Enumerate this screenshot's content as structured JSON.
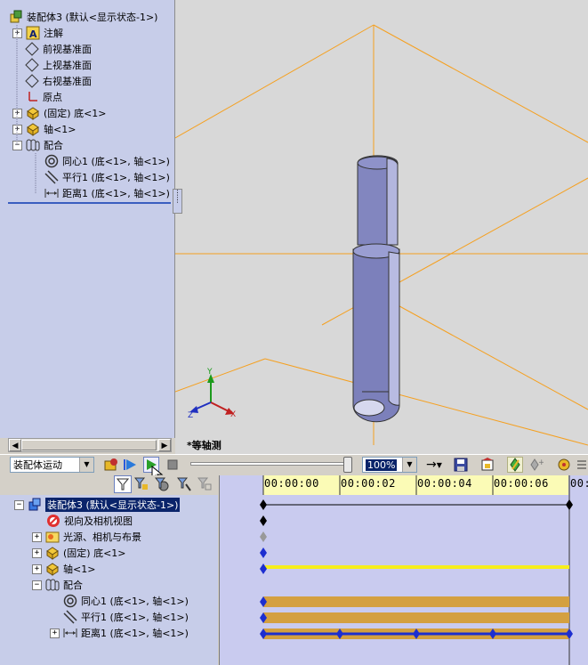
{
  "feature_tree": {
    "root": "装配体3  (默认<显示状态-1>)",
    "items": [
      {
        "label": "注解",
        "icon": "annotation-icon",
        "expandable": true
      },
      {
        "label": "前视基准面",
        "icon": "plane-icon",
        "expandable": false
      },
      {
        "label": "上视基准面",
        "icon": "plane-icon",
        "expandable": false
      },
      {
        "label": "右视基准面",
        "icon": "plane-icon",
        "expandable": false
      },
      {
        "label": "原点",
        "icon": "origin-icon",
        "expandable": false
      },
      {
        "label": "(固定) 底<1>",
        "icon": "part-icon",
        "expandable": true
      },
      {
        "label": "轴<1>",
        "icon": "part-icon",
        "expandable": true
      },
      {
        "label": "配合",
        "icon": "mates-icon",
        "expandable": true,
        "expanded": true
      },
      {
        "label": "同心1  (底<1>, 轴<1>)",
        "icon": "concentric-icon",
        "child": true
      },
      {
        "label": "平行1  (底<1>, 轴<1>)",
        "icon": "parallel-icon",
        "child": true
      },
      {
        "label": "距离1  (底<1>, 轴<1>)",
        "icon": "distance-icon",
        "child": true
      }
    ]
  },
  "viewport": {
    "view_label": "*等轴测"
  },
  "motion_toolbar": {
    "study_type": "装配体运动",
    "zoom": "100%"
  },
  "motion_tree": {
    "root": "装配体3  (默认<显示状态-1>)",
    "items": [
      {
        "label": "视向及相机视图",
        "icon": "camera-view-icon"
      },
      {
        "label": "光源、相机与布景",
        "icon": "lights-icon",
        "expandable": true
      },
      {
        "label": "(固定) 底<1>",
        "icon": "part-icon",
        "expandable": true
      },
      {
        "label": "轴<1>",
        "icon": "part-icon",
        "expandable": true
      },
      {
        "label": "配合",
        "icon": "mates-icon",
        "expandable": true,
        "expanded": true
      },
      {
        "label": "同心1  (底<1>, 轴<1>)",
        "icon": "concentric-icon"
      },
      {
        "label": "平行1  (底<1>, 轴<1>)",
        "icon": "parallel-icon"
      },
      {
        "label": "距离1  (底<1>, 轴<1>)",
        "icon": "distance-icon",
        "expandable": true
      }
    ]
  },
  "timeline": {
    "ticks": [
      "00:00:00",
      "00:00:02",
      "00:00:04",
      "00:00:06",
      "00:"
    ],
    "colors": {
      "header": "#fbfbb6",
      "mate_bar": "#d4a040",
      "part_bar": "#f6ee1c",
      "key": "#1c2ed0",
      "grid_bg": "#c9cbef"
    }
  }
}
